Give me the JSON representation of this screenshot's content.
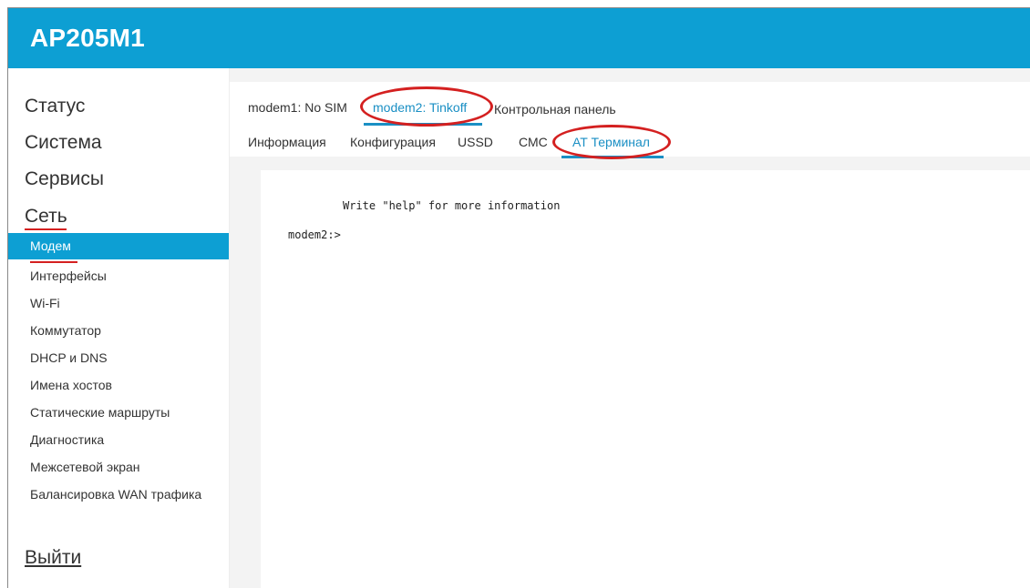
{
  "app": {
    "title": "AP205M1"
  },
  "sidebar": {
    "main_items": [
      {
        "label": "Статус"
      },
      {
        "label": "Система"
      },
      {
        "label": "Сервисы"
      },
      {
        "label": "Сеть"
      }
    ],
    "sub_items": [
      {
        "label": "Модем",
        "active": true
      },
      {
        "label": "Интерфейсы"
      },
      {
        "label": "Wi-Fi"
      },
      {
        "label": "Коммутатор"
      },
      {
        "label": "DHCP и DNS"
      },
      {
        "label": "Имена хостов"
      },
      {
        "label": "Статические маршруты"
      },
      {
        "label": "Диагностика"
      },
      {
        "label": "Межсетевой экран"
      },
      {
        "label": "Балансировка WAN трафика"
      }
    ],
    "logout": "Выйти"
  },
  "tabs": {
    "modems": [
      {
        "label": "modem1: No SIM"
      },
      {
        "label": "modem2: Tinkoff",
        "active": true
      },
      {
        "label": "Контрольная панель"
      }
    ],
    "sections": [
      {
        "label": "Информация"
      },
      {
        "label": "Конфигурация"
      },
      {
        "label": "USSD"
      },
      {
        "label": "СМС"
      },
      {
        "label": "AT Терминал",
        "active": true
      }
    ]
  },
  "terminal": {
    "help_line": "Write \"help\" for more information",
    "prompt": "modem2:>"
  },
  "colors": {
    "accent": "#0d9fd3",
    "highlight_circle": "#d42020",
    "active_tab": "#1a8fc4"
  }
}
